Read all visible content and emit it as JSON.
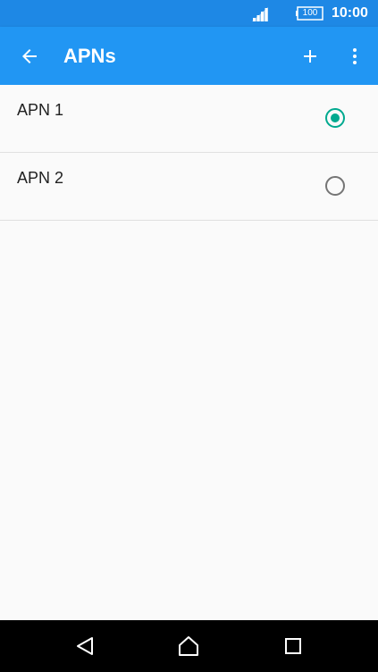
{
  "status_bar": {
    "battery_level": "100",
    "time": "10:00",
    "icons": [
      "signal-icon",
      "battery-icon"
    ]
  },
  "app_bar": {
    "title": "APNs",
    "icons": [
      "arrow-back-icon",
      "plus-icon",
      "more-vert-icon"
    ]
  },
  "apn_list": [
    {
      "name": "APN 1",
      "selected": true
    },
    {
      "name": "APN 2",
      "selected": false
    }
  ],
  "nav_bar": {
    "icons": [
      "triangle-back-icon",
      "home-icon",
      "square-recent-icon"
    ]
  },
  "colors": {
    "status_bar": "#1e88e5",
    "app_bar": "#2196f3",
    "accent": "#00a98f",
    "background": "#fafafa",
    "divider": "#e0e0e0",
    "radio_unselected": "#757575",
    "nav_bar": "#000000"
  }
}
